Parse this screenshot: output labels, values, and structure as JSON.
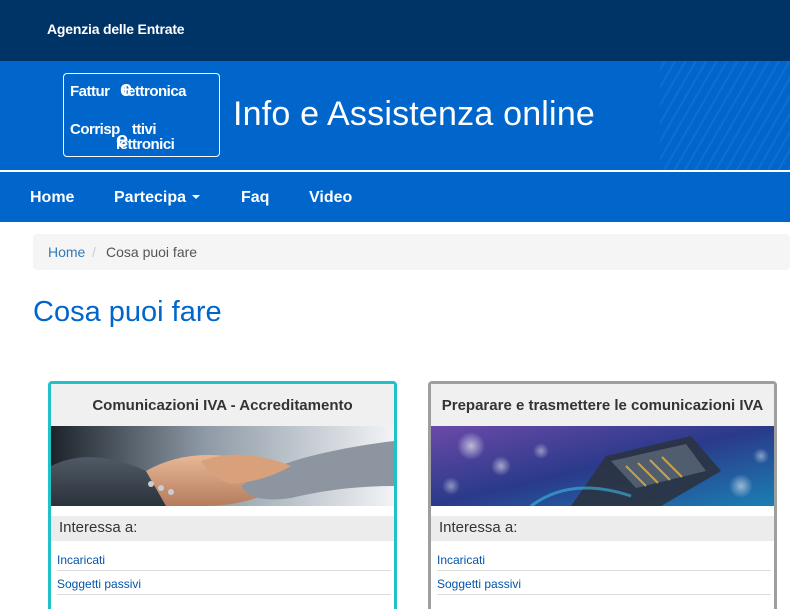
{
  "topbar": {
    "agency": "Agenzia delle Entrate"
  },
  "header": {
    "logo": {
      "line1": "Fattur",
      "line2": "Corrisp",
      "line2b": "ttivi",
      "line3": "lettronici",
      "line1b": "lettronica",
      "e_glyph": "e"
    },
    "title": "Info e Assistenza online"
  },
  "nav": {
    "home": "Home",
    "partecipa": "Partecipa",
    "faq": "Faq",
    "video": "Video"
  },
  "breadcrumb": {
    "home": "Home",
    "separator": "/",
    "current": "Cosa puoi fare"
  },
  "page_title": "Cosa puoi fare",
  "cards": [
    {
      "title": "Comunicazioni IVA - Accreditamento",
      "image": "handshake-image",
      "subtitle": "Interessa a:",
      "links": [
        "Incaricati",
        "Soggetti passivi"
      ]
    },
    {
      "title": "Preparare e trasmettere le comunicazioni IVA",
      "image": "network-cable-image",
      "subtitle": "Interessa a:",
      "links": [
        "Incaricati",
        "Soggetti passivi"
      ]
    }
  ],
  "colors": {
    "topbar": "#003366",
    "brand_blue": "#0066cc",
    "card1_border": "#21c1c8",
    "card2_border": "#9e9e9e",
    "link": "#337ab7"
  }
}
